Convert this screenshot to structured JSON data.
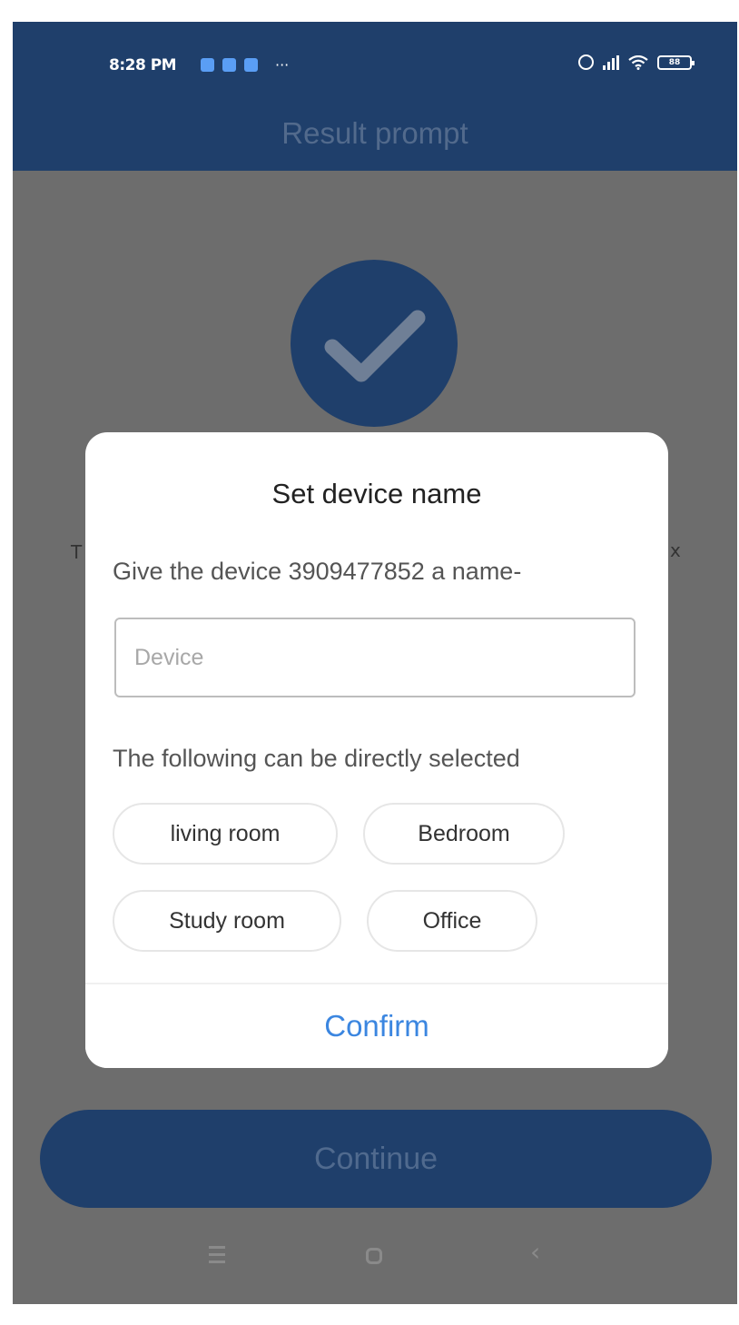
{
  "status_bar": {
    "time": "8:28 PM",
    "more": "···",
    "battery": "88"
  },
  "appbar": {
    "title": "Result prompt"
  },
  "background": {
    "left_fragment": "T",
    "right_fragment": "x",
    "continue_label": "Continue"
  },
  "dialog": {
    "title": "Set device name",
    "prompt": "Give the device 3909477852 a name-",
    "input": {
      "value": "",
      "placeholder": "Device"
    },
    "suggestions_label": "The following can be directly selected",
    "suggestions": [
      "living room",
      "Bedroom",
      "Study room",
      "Office"
    ],
    "confirm_label": "Confirm"
  },
  "nav_bar": {
    "back_glyph": "‹"
  },
  "colors": {
    "appbar": "#1f3f6b",
    "overlay": "#6d6d6d",
    "confirm": "#3b86e0",
    "notification_icon": "#5a9ef5"
  },
  "icons": [
    "notification-icon",
    "alarm-icon",
    "signal-icon",
    "wifi-icon",
    "battery-icon",
    "checkmark-icon",
    "menu-icon",
    "home-icon",
    "back-icon"
  ]
}
